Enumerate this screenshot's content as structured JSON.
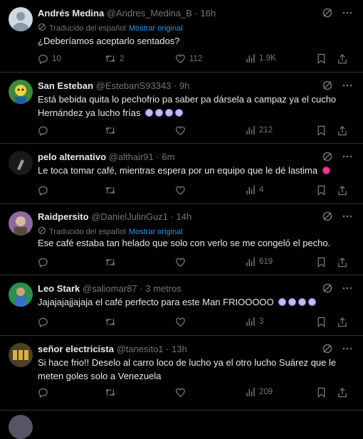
{
  "translate_label": "Traducido del español",
  "show_original": "Mostrar original",
  "tweets": [
    {
      "name": "Andrés Medina",
      "handle": "@Andres_Medina_B",
      "time": "· 16h",
      "translated": true,
      "text": "¿Deberíamos aceptarlo sentados?",
      "replies": "10",
      "retweets": "2",
      "likes": "112",
      "views": "1.9K"
    },
    {
      "name": "San Esteban",
      "handle": "@EstebanS93343",
      "time": "· 9h",
      "translated": false,
      "text": "Está bebida quita lo pechofrio pa saber pa dársela a campaz ya el cucho Hernández ya lucho frías",
      "replies": "",
      "retweets": "",
      "likes": "",
      "views": "212"
    },
    {
      "name": "pelo alternativo",
      "handle": "@althair91",
      "time": "· 6m",
      "translated": false,
      "text": "Le toca tomar café, mientras espera por un equipo que le dé lastima",
      "replies": "",
      "retweets": "",
      "likes": "",
      "views": "4"
    },
    {
      "name": "Raidpersito",
      "handle": "@DanielJulinGuz1",
      "time": "· 14h",
      "translated": true,
      "text": "Ese café estaba tan helado que solo con verlo se me congeló el pecho.",
      "replies": "",
      "retweets": "",
      "likes": "",
      "views": "619"
    },
    {
      "name": "Leo Stark",
      "handle": "@saliomar87",
      "time": "· 3 metros",
      "translated": false,
      "text": "Jajajajajjajaja el café perfecto para este Man FRIOOOOO",
      "replies": "",
      "retweets": "",
      "likes": "",
      "views": "3"
    },
    {
      "name": "señor electricista",
      "handle": "@tanesito1",
      "time": "· 13h",
      "translated": false,
      "text": "Si hace frio!! Deselo al carro loco de lucho ya el otro lucho Suárez que le meten goles solo a Venezuela",
      "replies": "",
      "retweets": "",
      "likes": "",
      "views": "209"
    }
  ]
}
